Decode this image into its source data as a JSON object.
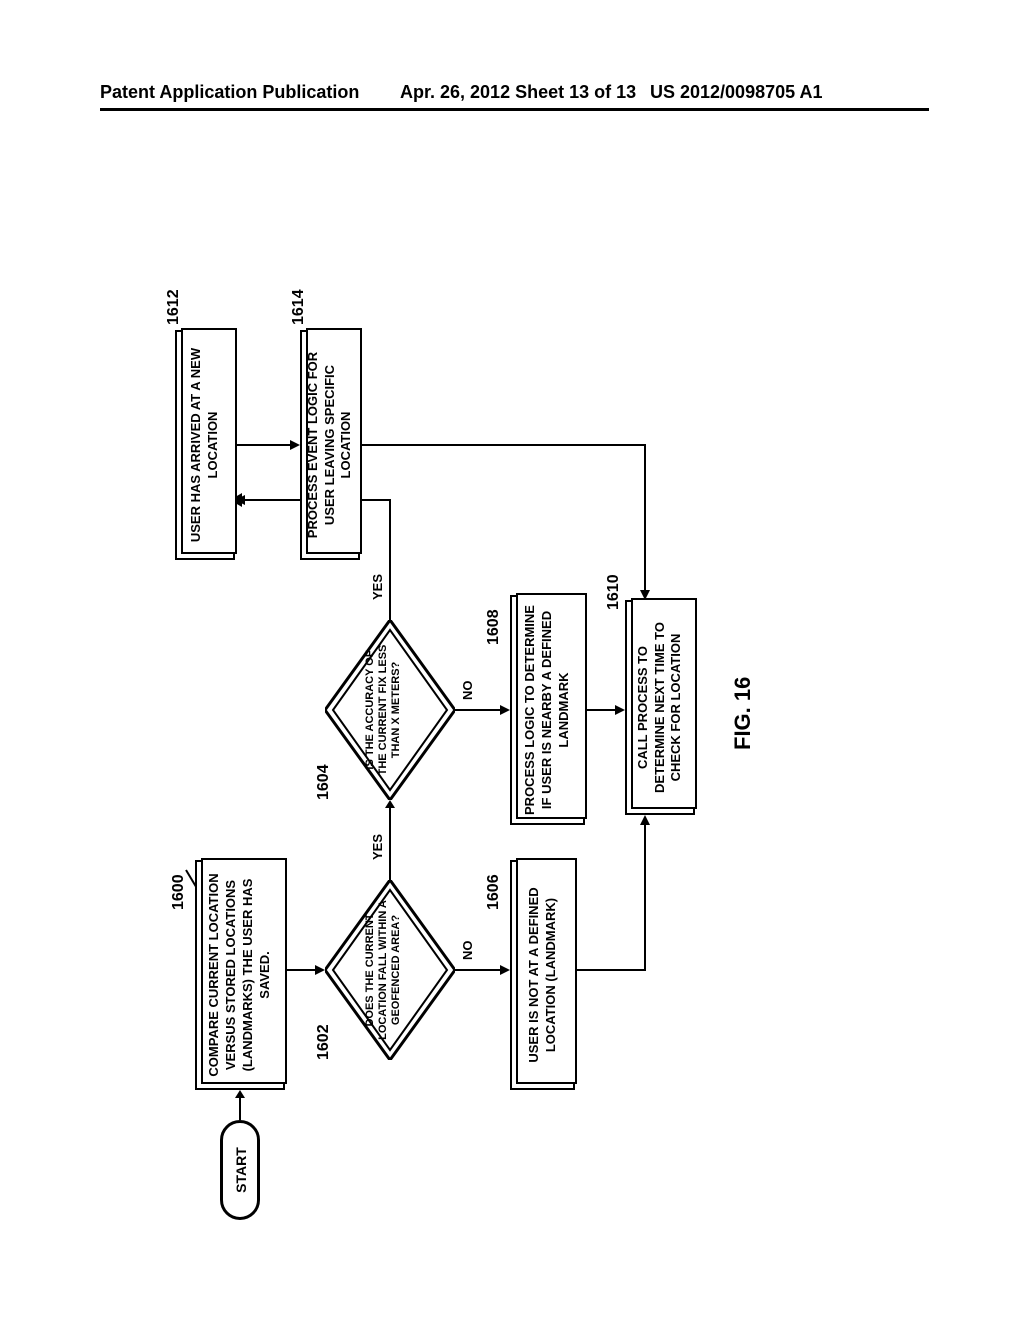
{
  "header": {
    "left": "Patent Application Publication",
    "mid": "Apr. 26, 2012  Sheet 13 of 13",
    "right": "US 2012/0098705 A1"
  },
  "ref": {
    "r1600": "1600",
    "r1602": "1602",
    "r1604": "1604",
    "r1606": "1606",
    "r1608": "1608",
    "r1610": "1610",
    "r1612": "1612",
    "r1614": "1614"
  },
  "labels": {
    "start": "START",
    "yes1": "YES",
    "no1": "NO",
    "yes2": "YES",
    "no2": "NO",
    "fig": "FIG. 16"
  },
  "boxes": {
    "b1600": "COMPARE CURRENT LOCATION VERSUS STORED LOCATIONS (LANDMARKS) THE USER HAS SAVED.",
    "d1602": "DOES THE CURRENT LOCATION FALL WITHIN A GEOFENCED AREA?",
    "d1604": "IS THE ACCURACY OF THE CURRENT FIX LESS THAN X METERS?",
    "b1606": "USER IS NOT AT A DEFINED LOCATION (LANDMARK)",
    "b1608": "PROCESS LOGIC TO DETERMINE IF USER IS NEARBY A DEFINED LANDMARK",
    "b1610": "CALL PROCESS TO DETERMINE NEXT TIME TO CHECK FOR LOCATION",
    "b1612": "USER HAS ARRIVED AT A NEW LOCATION",
    "b1614": "PROCESS EVENT LOGIC FOR USER LEAVING SPECIFIC LOCATION"
  },
  "chart_data": {
    "type": "flowchart",
    "nodes": [
      {
        "id": "start",
        "shape": "terminator",
        "text": "START"
      },
      {
        "id": "1600",
        "shape": "process",
        "text": "COMPARE CURRENT LOCATION VERSUS STORED LOCATIONS (LANDMARKS) THE USER HAS SAVED."
      },
      {
        "id": "1602",
        "shape": "decision",
        "text": "DOES THE CURRENT LOCATION FALL WITHIN A GEOFENCED AREA?"
      },
      {
        "id": "1604",
        "shape": "decision",
        "text": "IS THE ACCURACY OF THE CURRENT FIX LESS THAN X METERS?"
      },
      {
        "id": "1606",
        "shape": "process",
        "text": "USER IS NOT AT A DEFINED LOCATION (LANDMARK)"
      },
      {
        "id": "1608",
        "shape": "process",
        "text": "PROCESS LOGIC TO DETERMINE IF USER IS NEARBY A DEFINED LANDMARK"
      },
      {
        "id": "1610",
        "shape": "process",
        "text": "CALL PROCESS TO DETERMINE NEXT TIME TO CHECK FOR LOCATION"
      },
      {
        "id": "1612",
        "shape": "process",
        "text": "USER HAS ARRIVED AT A NEW LOCATION"
      },
      {
        "id": "1614",
        "shape": "process",
        "text": "PROCESS EVENT LOGIC FOR USER LEAVING SPECIFIC LOCATION"
      }
    ],
    "edges": [
      {
        "from": "start",
        "to": "1600"
      },
      {
        "from": "1600",
        "to": "1602"
      },
      {
        "from": "1602",
        "to": "1604",
        "label": "YES"
      },
      {
        "from": "1602",
        "to": "1606",
        "label": "NO"
      },
      {
        "from": "1604",
        "to": "1612",
        "label": "YES"
      },
      {
        "from": "1604",
        "to": "1608",
        "label": "NO"
      },
      {
        "from": "1606",
        "to": "1610"
      },
      {
        "from": "1608",
        "to": "1610"
      },
      {
        "from": "1612",
        "to": "1614"
      },
      {
        "from": "1614",
        "to": "1610"
      }
    ]
  }
}
